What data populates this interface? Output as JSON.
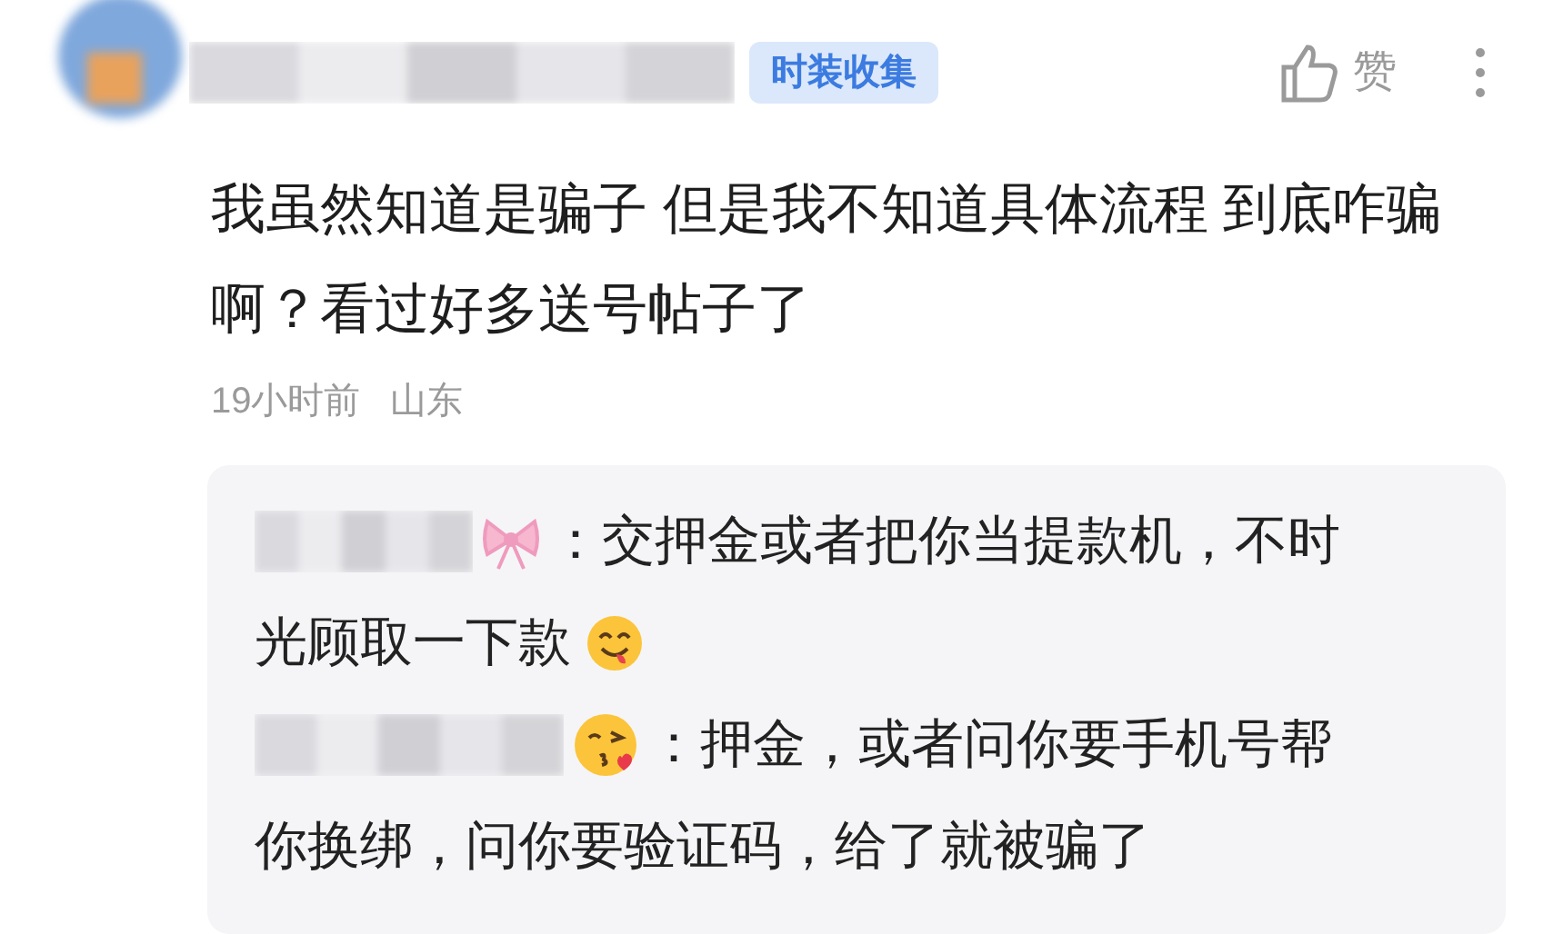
{
  "header": {
    "badge": "时装收集",
    "like_label": "赞"
  },
  "post": {
    "text": "我虽然知道是骗子 但是我不知道具体流程 到底咋骗啊？看过好多送号帖子了",
    "time": "19小时前",
    "location": "山东"
  },
  "replies": [
    {
      "kind": "bow",
      "lines": [
        "：交押金或者把你当提款机，不时",
        "光顾取一下款"
      ],
      "trailing_emoji": true
    },
    {
      "kind": "wink",
      "lines": [
        "：押金，或者问你要手机号帮",
        "你换绑，问你要验证码，给了就被骗了"
      ],
      "trailing_emoji": false
    }
  ]
}
